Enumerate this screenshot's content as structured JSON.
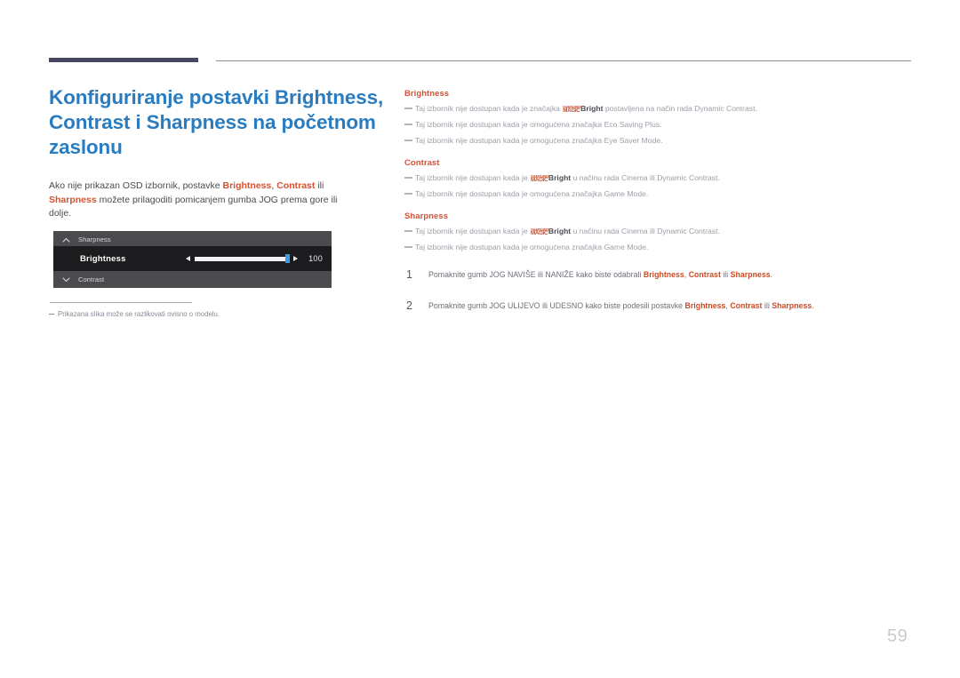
{
  "document": {
    "page_number": "59"
  },
  "left": {
    "title": "Konfiguriranje postavki Brightness, Contrast i Sharpness na početnom zaslonu",
    "intro_parts": {
      "p1": "Ako nije prikazan OSD izbornik, postavke ",
      "hl1": "Brightness",
      "p2": ", ",
      "hl2": "Contrast",
      "p3": " ili ",
      "hl3": "Sharpness",
      "p4": " možete prilagoditi pomicanjem gumba JOG prema gore ili dolje."
    },
    "footnote": "Prikazana slika može se razlikovati ovisno o modelu."
  },
  "osd": {
    "top_item": "Sharpness",
    "active_item": "Brightness",
    "bottom_item": "Contrast",
    "value": "100",
    "chevron_up_icon": "chevron-up-icon",
    "chevron_down_icon": "chevron-down-icon",
    "arrow_left_icon": "arrow-left-icon",
    "arrow_right_icon": "arrow-right-icon"
  },
  "right": {
    "sections": [
      {
        "heading": "Brightness",
        "notes": [
          {
            "a": "Taj izbornik nije dostupan kada je značajka ",
            "logo": {
              "line1": "SAMSUNG",
              "line2": "MAGIC"
            },
            "bold1": "Bright",
            "b": " postavljena na način rada ",
            "bold2": "Dynamic Contrast",
            "c": "."
          },
          {
            "a": "Taj izbornik nije dostupan kada je omogućena značajka ",
            "bold2": "Eco Saving Plus",
            "c": "."
          },
          {
            "a": "Taj izbornik nije dostupan kada je omogućena značajka ",
            "bold2": "Eye Saver Mode",
            "c": "."
          }
        ]
      },
      {
        "heading": "Contrast",
        "notes": [
          {
            "a": "Taj izbornik nije dostupan kada je ",
            "logo": {
              "line1": "SAMSUNG",
              "line2": "MAGIC"
            },
            "bold1": "Bright",
            "b": " u načinu rada ",
            "bold2": "Cinema",
            "mid": " ili ",
            "bold3": "Dynamic Contrast",
            "c": "."
          },
          {
            "a": "Taj izbornik nije dostupan kada je omogućena značajka ",
            "bold2": "Game Mode",
            "c": "."
          }
        ]
      },
      {
        "heading": "Sharpness",
        "notes": [
          {
            "a": "Taj izbornik nije dostupan kada je ",
            "logo": {
              "line1": "SAMSUNG",
              "line2": "MAGIC"
            },
            "bold1": "Bright",
            "b": " u načinu rada ",
            "bold2": "Cinema",
            "mid": " ili ",
            "bold3": "Dynamic Contrast",
            "c": "."
          },
          {
            "a": "Taj izbornik nije dostupan kada je omogućena značajka ",
            "bold2": "Game Mode",
            "c": "."
          }
        ]
      }
    ]
  },
  "steps": [
    {
      "number": "1",
      "a": "Pomaknite gumb JOG NAVIŠE ili NANIŽE kako biste odabrali ",
      "b1": "Brightness",
      "sep1": ", ",
      "b2": "Contrast",
      "sep2": " ili ",
      "b3": "Sharpness",
      "end": "."
    },
    {
      "number": "2",
      "a": "Pomaknite gumb JOG ULIJEVO ili UDESNO kako biste podesili postavke ",
      "b1": "Brightness",
      "sep1": ", ",
      "b2": "Contrast",
      "sep2": " ili ",
      "b3": "Sharpness",
      "end": "."
    }
  ],
  "colors": {
    "title_blue": "#2a7cc0",
    "accent_red": "#cf4a24",
    "heading_red": "#d0533a",
    "rule_dark": "#474860",
    "osd_bg": "#4b4b4e",
    "osd_active_bg": "#1c1c1e",
    "slider_thumb": "#3e9ce0"
  }
}
